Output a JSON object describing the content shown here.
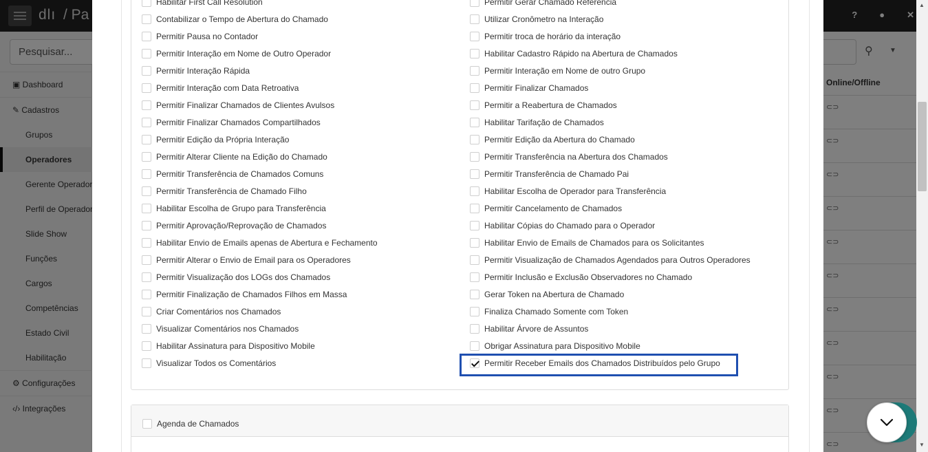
{
  "topbar": {
    "brand": "dlı",
    "crumb": "/  Pa",
    "icons": [
      "help-icon",
      "user-icon",
      "fullscreen-icon"
    ],
    "icon_glyphs": [
      "?",
      "●",
      "✕"
    ]
  },
  "sidebar": {
    "search_placeholder": "Pesquisar...",
    "dashboard": "Dashboard",
    "cadastros": "Cadastros",
    "sub_items": [
      "Grupos",
      "Operadores",
      "Gerente Operador",
      "Perfil de Operador",
      "Slide Show",
      "Funções",
      "Cargos",
      "Competências",
      "Estado Civil",
      "Habilitação"
    ],
    "active_item": "Operadores",
    "configuracoes": "Configurações",
    "integracoes": "Integrações"
  },
  "table_bg": {
    "column_header": "Online/Offline",
    "row_glyph": "⊂⊃"
  },
  "permissions": {
    "left": [
      "Habilitar First Call Resolution",
      "Contabilizar o Tempo de Abertura do Chamado",
      "Permitir Pausa no Contador",
      "Permitir Interação em Nome de Outro Operador",
      "Permitir Interação Rápida",
      "Permitir Interação com Data Retroativa",
      "Permitir Finalizar Chamados de Clientes Avulsos",
      "Permitir Finalizar Chamados Compartilhados",
      "Permitir Edição da Própria Interação",
      "Permitir Alterar Cliente na Edição do Chamado",
      "Permitir Transferência de Chamados Comuns",
      "Permitir Transferência de Chamado Filho",
      "Habilitar Escolha de Grupo para Transferência",
      "Permitir Aprovação/Reprovação de Chamados",
      "Habilitar Envio de Emails apenas de Abertura e Fechamento",
      "Permitir Alterar o Envio de Email para os Operadores",
      "Permitir Visualização dos LOGs dos Chamados",
      "Permitir Finalização de Chamados Filhos em Massa",
      "Criar Comentários nos Chamados",
      "Visualizar Comentários nos Chamados",
      "Habilitar Assinatura para Dispositivo Mobile",
      "Visualizar Todos os Comentários"
    ],
    "right": [
      "Permitir Gerar Chamado Referência",
      "Utilizar Cronômetro na Interação",
      "Permitir troca de horário da interação",
      "Habilitar Cadastro Rápido na Abertura de Chamados",
      "Permitir Interação em Nome de outro Grupo",
      "Permitir Finalizar Chamados",
      "Permitir a Reabertura de Chamados",
      "Habilitar Tarifação de Chamados",
      "Permitir Edição da Abertura do Chamado",
      "Permitir Transferência na Abertura dos Chamados",
      "Permitir Transferência de Chamado Pai",
      "Habilitar Escolha de Operador para Transferência",
      "Permitir Cancelamento de Chamados",
      "Habilitar Cópias do Chamado para o Operador",
      "Habilitar Envio de Emails de Chamados para os Solicitantes",
      "Permitir Visualização de Chamados Agendados para Outros Operadores",
      "Permitir Inclusão e Exclusão Observadores no Chamado",
      "Gerar Token na Abertura de Chamado",
      "Finaliza Chamado Somente com Token",
      "Habilitar Árvore de Assuntos",
      "Obrigar Assinatura para Dispositivo Mobile",
      "Permitir Receber Emails dos Chamados Distribuídos pelo Grupo"
    ],
    "checked_right": [
      "Permitir Receber Emails dos Chamados Distribuídos pelo Grupo"
    ]
  },
  "section2": {
    "label": "Agenda de Chamados"
  },
  "highlight_color": "#1f4fb0",
  "fab_icon": "chevron-down-icon"
}
